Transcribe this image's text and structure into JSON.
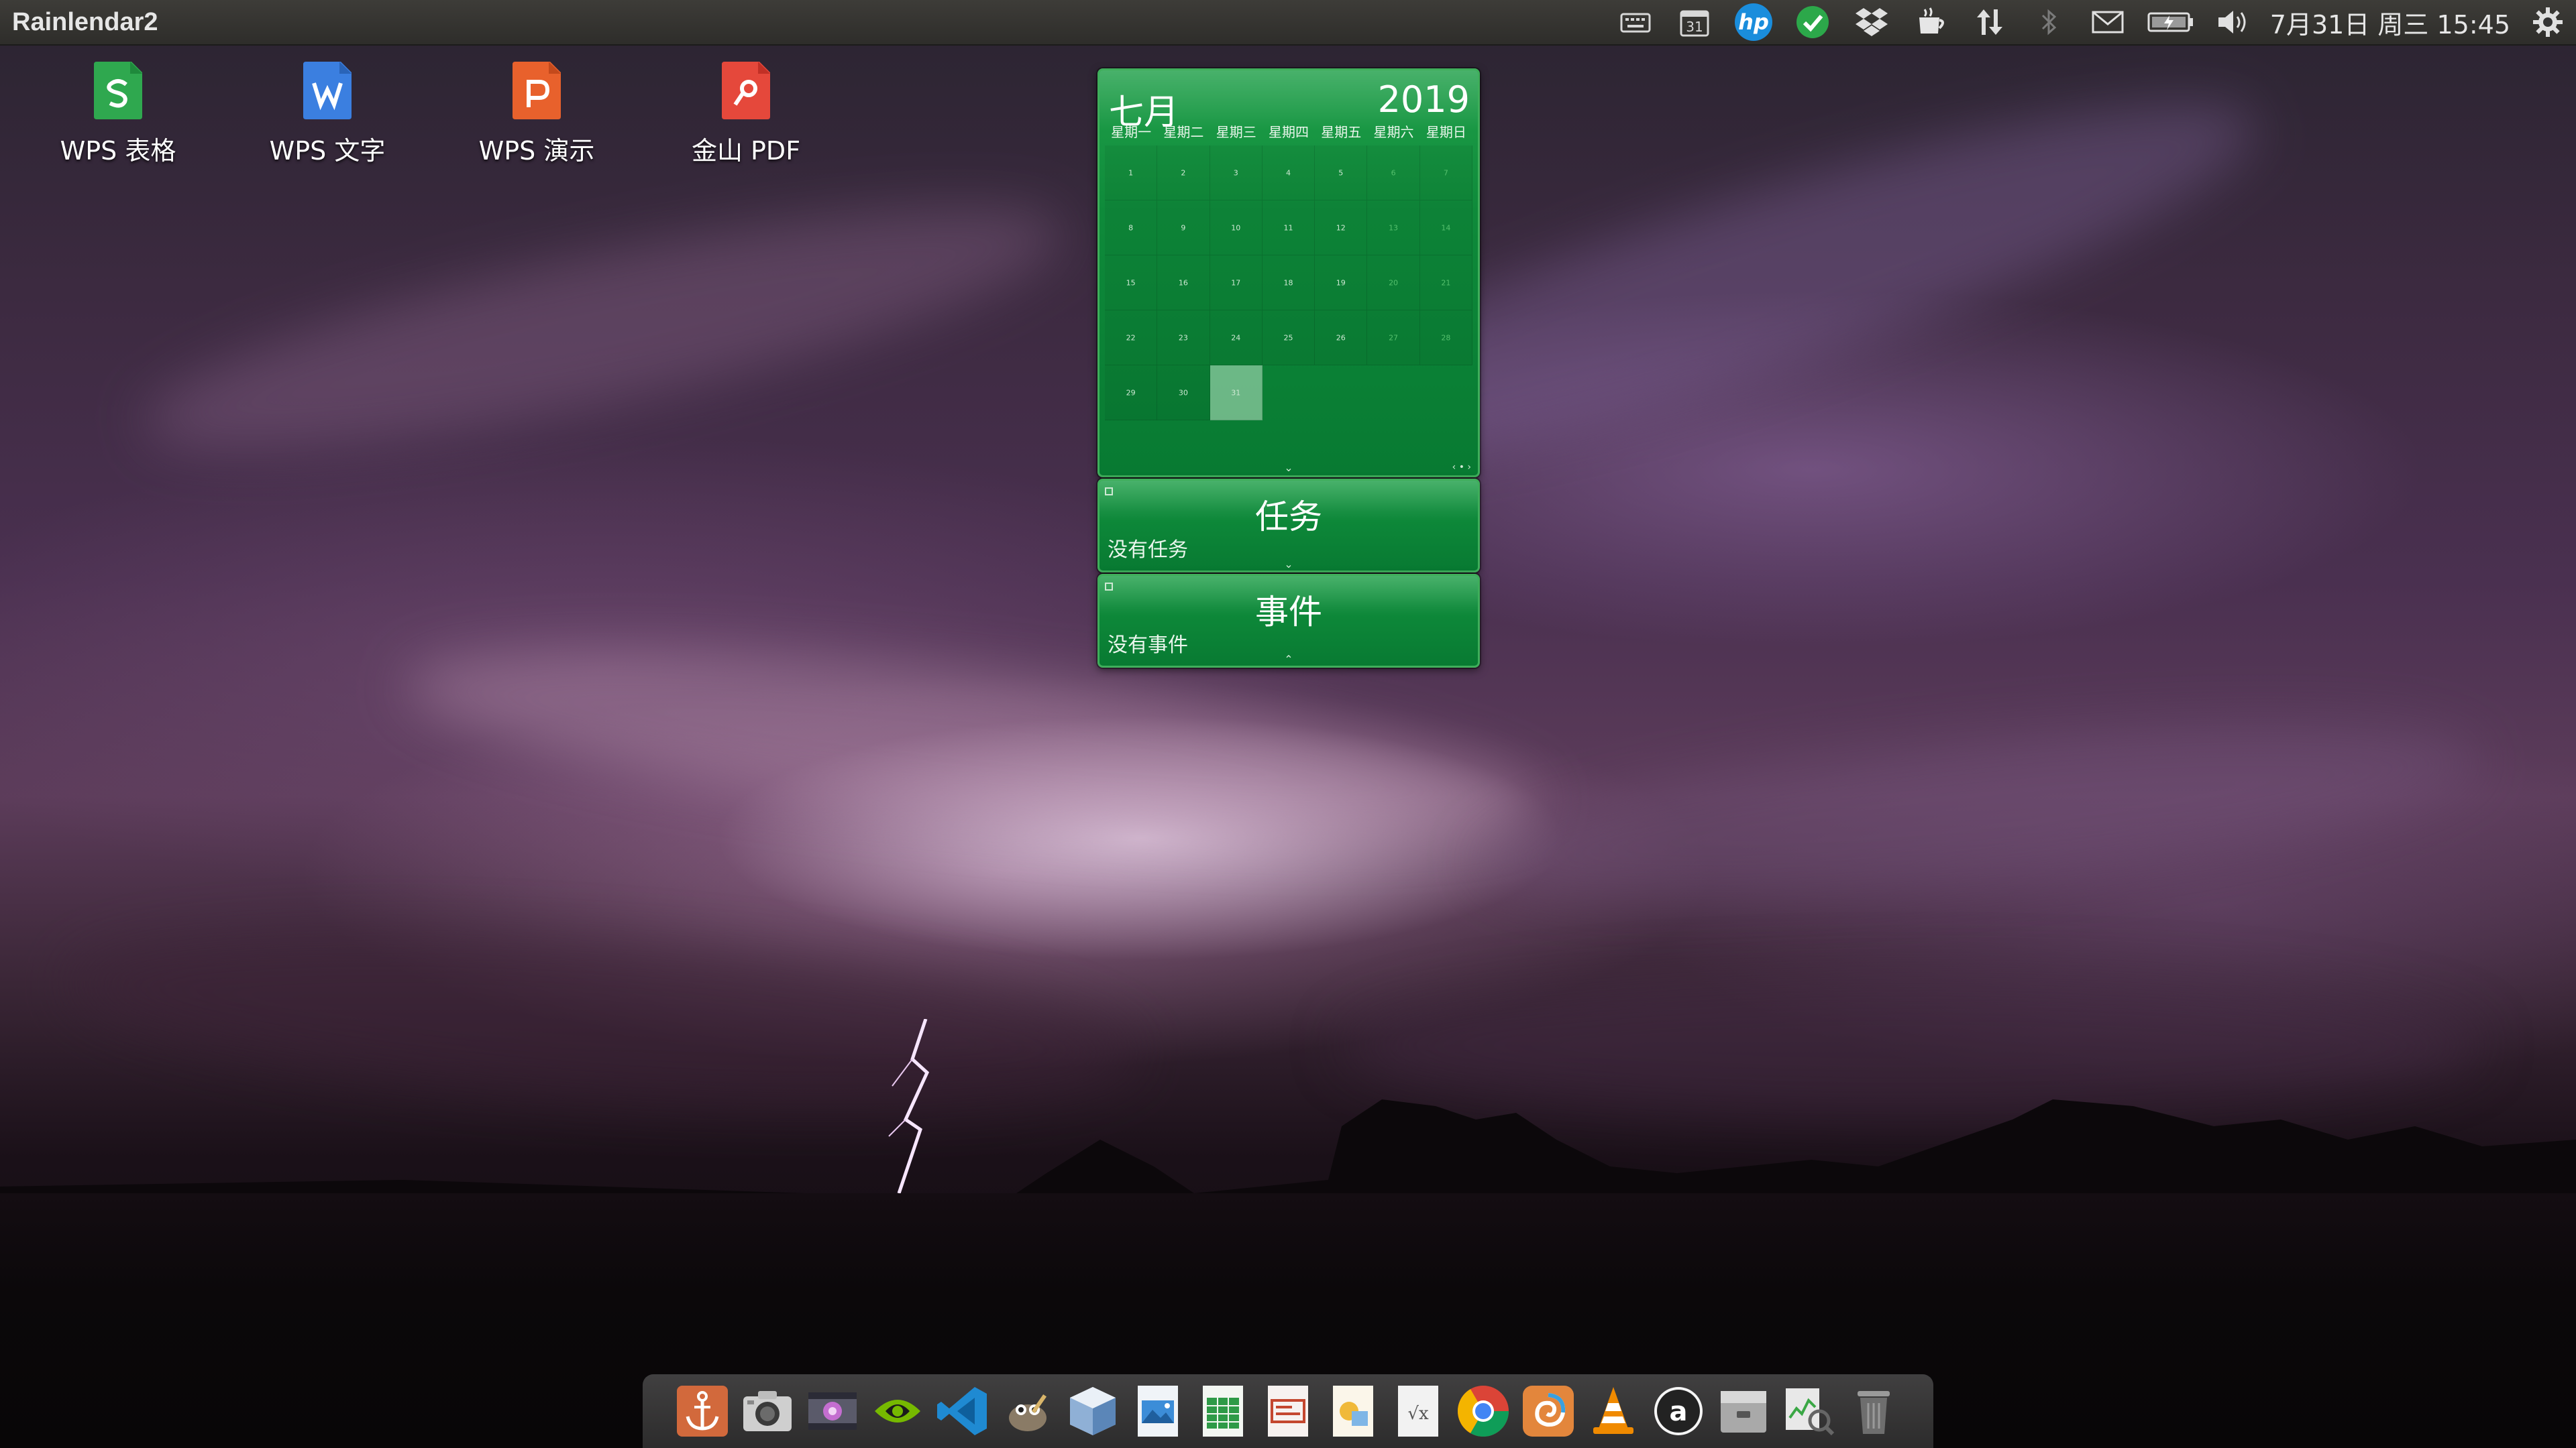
{
  "top_panel": {
    "app_title": "Rainlendar2",
    "indicators": [
      {
        "icon": "keyboard-icon"
      },
      {
        "icon": "calendar-indicator-icon",
        "text": "31"
      },
      {
        "icon": "hp-icon",
        "text": "hp"
      },
      {
        "icon": "sync-ok-icon"
      },
      {
        "icon": "dropbox-icon"
      },
      {
        "icon": "caffeine-icon"
      },
      {
        "icon": "network-icon"
      },
      {
        "icon": "bluetooth-icon"
      },
      {
        "icon": "mail-icon"
      },
      {
        "icon": "battery-icon"
      },
      {
        "icon": "volume-icon"
      }
    ],
    "clock": "7月31日 周三 15:45",
    "settings_icon": "gear-icon"
  },
  "desktop_icons": [
    {
      "label": "WPS 表格",
      "icon": "wps-spreadsheet-icon",
      "color": "#2fa84f",
      "glyph": "S"
    },
    {
      "label": "WPS 文字",
      "icon": "wps-writer-icon",
      "color": "#3b7fe0",
      "glyph": "W"
    },
    {
      "label": "WPS 演示",
      "icon": "wps-presentation-icon",
      "color": "#e8612c",
      "glyph": "P"
    },
    {
      "label": "金山 PDF",
      "icon": "kingsoft-pdf-icon",
      "color": "#e5483b",
      "glyph": "P"
    }
  ],
  "calendar": {
    "month": "七月",
    "year": "2019",
    "weekdays": [
      "星期一",
      "星期二",
      "星期三",
      "星期四",
      "星期五",
      "星期六",
      "星期日"
    ],
    "today": 31,
    "accent": "#0e8a3a"
  },
  "tasks": {
    "title": "任务",
    "empty_text": "没有任务"
  },
  "events": {
    "title": "事件",
    "empty_text": "没有事件"
  },
  "dock": {
    "items": [
      {
        "icon": "anchor-icon"
      },
      {
        "icon": "camera-icon"
      },
      {
        "icon": "video-icon"
      },
      {
        "icon": "nvidia-icon"
      },
      {
        "icon": "vscode-icon"
      },
      {
        "icon": "gimp-icon"
      },
      {
        "icon": "virtualbox-icon"
      },
      {
        "icon": "image-viewer-icon"
      },
      {
        "icon": "spreadsheet-doc-icon"
      },
      {
        "icon": "presentation-doc-icon"
      },
      {
        "icon": "draw-doc-icon"
      },
      {
        "icon": "formula-doc-icon"
      },
      {
        "icon": "chrome-icon"
      },
      {
        "icon": "swirl-app-icon"
      },
      {
        "icon": "vlc-icon"
      },
      {
        "icon": "amazon-icon"
      },
      {
        "icon": "file-archive-icon"
      },
      {
        "icon": "system-monitor-icon"
      },
      {
        "icon": "trash-icon"
      }
    ]
  }
}
